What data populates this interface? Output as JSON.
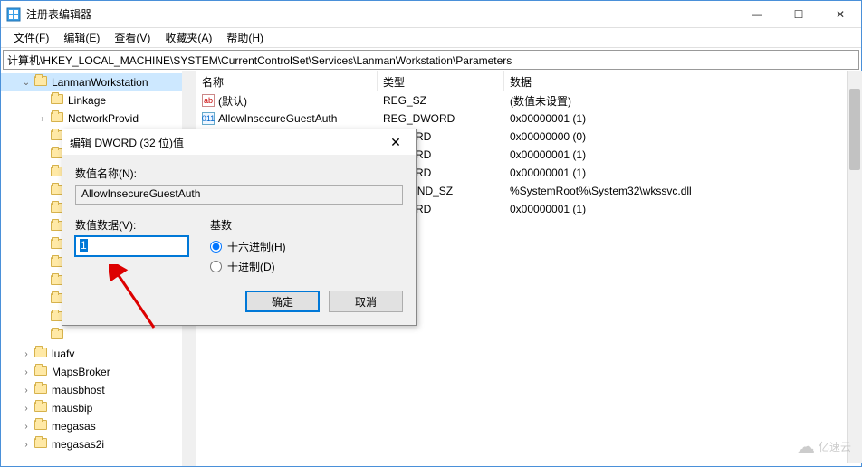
{
  "window": {
    "title": "注册表编辑器"
  },
  "menu": {
    "file": "文件(F)",
    "edit": "编辑(E)",
    "view": "查看(V)",
    "fav": "收藏夹(A)",
    "help": "帮助(H)"
  },
  "address": "计算机\\HKEY_LOCAL_MACHINE\\SYSTEM\\CurrentControlSet\\Services\\LanmanWorkstation\\Parameters",
  "tree": {
    "items": [
      {
        "label": "LanmanWorkstation",
        "indent": 1,
        "exp": "v",
        "sel": true
      },
      {
        "label": "Linkage",
        "indent": 2,
        "exp": ""
      },
      {
        "label": "NetworkProvid",
        "indent": 2,
        "exp": ">"
      },
      {
        "label": "",
        "indent": 2,
        "exp": ""
      },
      {
        "label": "",
        "indent": 2,
        "exp": ""
      },
      {
        "label": "",
        "indent": 2,
        "exp": ""
      },
      {
        "label": "",
        "indent": 2,
        "exp": ""
      },
      {
        "label": "",
        "indent": 2,
        "exp": ""
      },
      {
        "label": "",
        "indent": 2,
        "exp": ""
      },
      {
        "label": "",
        "indent": 2,
        "exp": ""
      },
      {
        "label": "",
        "indent": 2,
        "exp": ""
      },
      {
        "label": "",
        "indent": 2,
        "exp": ""
      },
      {
        "label": "",
        "indent": 2,
        "exp": ""
      },
      {
        "label": "",
        "indent": 2,
        "exp": ""
      },
      {
        "label": "",
        "indent": 2,
        "exp": ""
      },
      {
        "label": "luafv",
        "indent": 1,
        "exp": ">"
      },
      {
        "label": "MapsBroker",
        "indent": 1,
        "exp": ">"
      },
      {
        "label": "mausbhost",
        "indent": 1,
        "exp": ">"
      },
      {
        "label": "mausbip",
        "indent": 1,
        "exp": ">"
      },
      {
        "label": "megasas",
        "indent": 1,
        "exp": ">"
      },
      {
        "label": "megasas2i",
        "indent": 1,
        "exp": ">"
      }
    ]
  },
  "list": {
    "cols": {
      "name": "名称",
      "type": "类型",
      "data": "数据"
    },
    "rows": [
      {
        "icon": "str",
        "name": "(默认)",
        "type": "REG_SZ",
        "data": "(数值未设置)"
      },
      {
        "icon": "bin",
        "name": "AllowInsecureGuestAuth",
        "type": "REG_DWORD",
        "data": "0x00000001 (1)"
      },
      {
        "icon": "bin",
        "name": "",
        "type": "_DWORD",
        "data": "0x00000000 (0)"
      },
      {
        "icon": "bin",
        "name": "",
        "type": "_DWORD",
        "data": "0x00000001 (1)"
      },
      {
        "icon": "bin",
        "name": "",
        "type": "_DWORD",
        "data": "0x00000001 (1)"
      },
      {
        "icon": "str",
        "name": "",
        "type": "_EXPAND_SZ",
        "data": "%SystemRoot%\\System32\\wkssvc.dll"
      },
      {
        "icon": "bin",
        "name": "",
        "type": "_DWORD",
        "data": "0x00000001 (1)"
      }
    ]
  },
  "dialog": {
    "title": "编辑 DWORD (32 位)值",
    "name_label": "数值名称(N):",
    "name_value": "AllowInsecureGuestAuth",
    "data_label": "数值数据(V):",
    "data_value": "1",
    "base_label": "基数",
    "hex": "十六进制(H)",
    "dec": "十进制(D)",
    "ok": "确定",
    "cancel": "取消"
  },
  "watermark": "亿速云"
}
